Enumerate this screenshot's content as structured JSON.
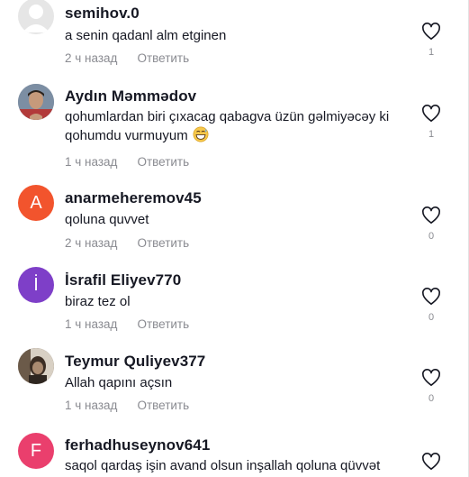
{
  "comments": [
    {
      "username": "semihov.0",
      "text": "a senin qadanl alm etginen",
      "time": "2 ч назад",
      "reply": "Ответить",
      "likes": "1",
      "avatar": {
        "type": "default-silhouette",
        "bg": "#e6e6e6"
      }
    },
    {
      "username": "Aydın Məmmədov",
      "text": "qohumlardan biri çıxacag qabagva üzün gəlmiyəcəy ki qohumdu vurmuyum",
      "emoji": "grinning-sweat-emoji",
      "time": "1 ч назад",
      "reply": "Ответить",
      "likes": "1",
      "avatar": {
        "type": "photo",
        "bg": "#6f7f90"
      }
    },
    {
      "username": "anarmeheremov45",
      "text": "qoluna quvvet",
      "time": "2 ч назад",
      "reply": "Ответить",
      "likes": "0",
      "avatar": {
        "type": "letter",
        "letter": "A",
        "bg": "#f2542d"
      }
    },
    {
      "username": "İsrafil Eliyev770",
      "text": "biraz tez ol",
      "time": "1 ч назад",
      "reply": "Ответить",
      "likes": "0",
      "avatar": {
        "type": "letter",
        "letter": "İ",
        "bg": "#7e3fc8"
      }
    },
    {
      "username": "Teymur Quliyev377",
      "text": "Allah qapını açsın",
      "time": "1 ч назад",
      "reply": "Ответить",
      "likes": "0",
      "avatar": {
        "type": "photo",
        "bg": "#5a4a3c"
      }
    },
    {
      "username": "ferhadhuseynov641",
      "text": "saqol qardaş işin avand olsun inşallah qoluna qüvvət",
      "time": "",
      "reply": "",
      "likes": "",
      "avatar": {
        "type": "letter",
        "letter": "F",
        "bg": "#ea3f6d"
      }
    }
  ],
  "colors": {
    "username": "#161823",
    "meta": "#8a8b91",
    "like_icon": "#161823"
  }
}
